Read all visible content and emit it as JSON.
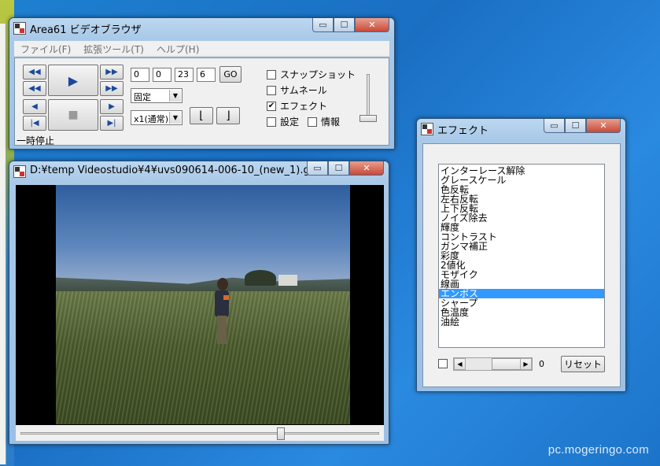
{
  "watermark": "pc.mogeringo.com",
  "main_window": {
    "title": "Area61 ビデオブラウザ",
    "controls": {
      "minimize": "▭",
      "maximize": "☐",
      "close": "✕"
    },
    "menu": [
      "ファイル(F)",
      "拡張ツール(T)",
      "ヘルプ(H)"
    ],
    "buttons": {
      "rewind_fast": "◀◀",
      "play": "▶",
      "forward_fast": "▶▶",
      "rewind": "◀◀",
      "forward": "▶▶",
      "step_back": "◀",
      "stop": "■",
      "step_forward": "▶",
      "frame_first": "|◀",
      "frame_last": "▶|",
      "go": "GO",
      "mark_in": "⌊",
      "mark_out": "⌋"
    },
    "time_fields": [
      "0",
      "0",
      "23",
      "6"
    ],
    "mode_select": "固定",
    "speed_select": "x1(通常)",
    "options": [
      {
        "label": "スナップショット",
        "checked": false
      },
      {
        "label": "サムネール",
        "checked": false
      },
      {
        "label": "エフェクト",
        "checked": true
      },
      {
        "label": "設定",
        "checked": false
      },
      {
        "label": "情報",
        "checked": false
      }
    ],
    "check_mark": "✔",
    "status": "一時停止"
  },
  "video_window": {
    "title": "D:¥temp Videostudio¥4¥uvs090614-006-10_(new_1).g...",
    "seek_position": 0.73
  },
  "effect_window": {
    "title": "エフェクト",
    "items": [
      "インターレース解除",
      "グレースケール",
      "色反転",
      "左右反転",
      "上下反転",
      "ノイズ除去",
      "輝度",
      "コントラスト",
      "ガンマ補正",
      "彩度",
      "2値化",
      "モザイク",
      "線画",
      "エンボス",
      "シャープ",
      "色温度",
      "油絵"
    ],
    "selected_index": 13,
    "value": "0",
    "reset_label": "リセット"
  }
}
